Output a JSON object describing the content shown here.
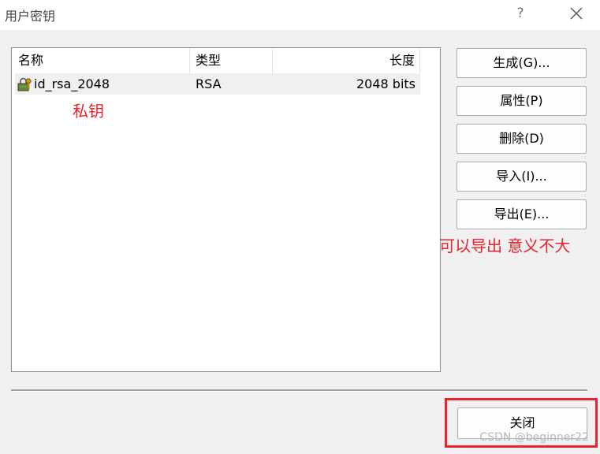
{
  "window": {
    "title": "用户密钥",
    "help_label": "?",
    "close_icon": "close-icon"
  },
  "keylist": {
    "columns": [
      "名称",
      "类型",
      "长度"
    ],
    "rows": [
      {
        "icon": "key-icon",
        "name": "id_rsa_2048",
        "type": "RSA",
        "length": "2048 bits"
      }
    ]
  },
  "buttons": {
    "generate": "生成(G)...",
    "properties": "属性(P)",
    "delete": "删除(D)",
    "import": "导入(I)...",
    "export": "导出(E)...",
    "close": "关闭"
  },
  "annotations": {
    "private_key": "私钥",
    "export_note": "可以导出 意义不大"
  },
  "watermark": "CSDN @beginner22",
  "colors": {
    "annotation": "#e8232b",
    "highlight_border": "#e8232b"
  }
}
